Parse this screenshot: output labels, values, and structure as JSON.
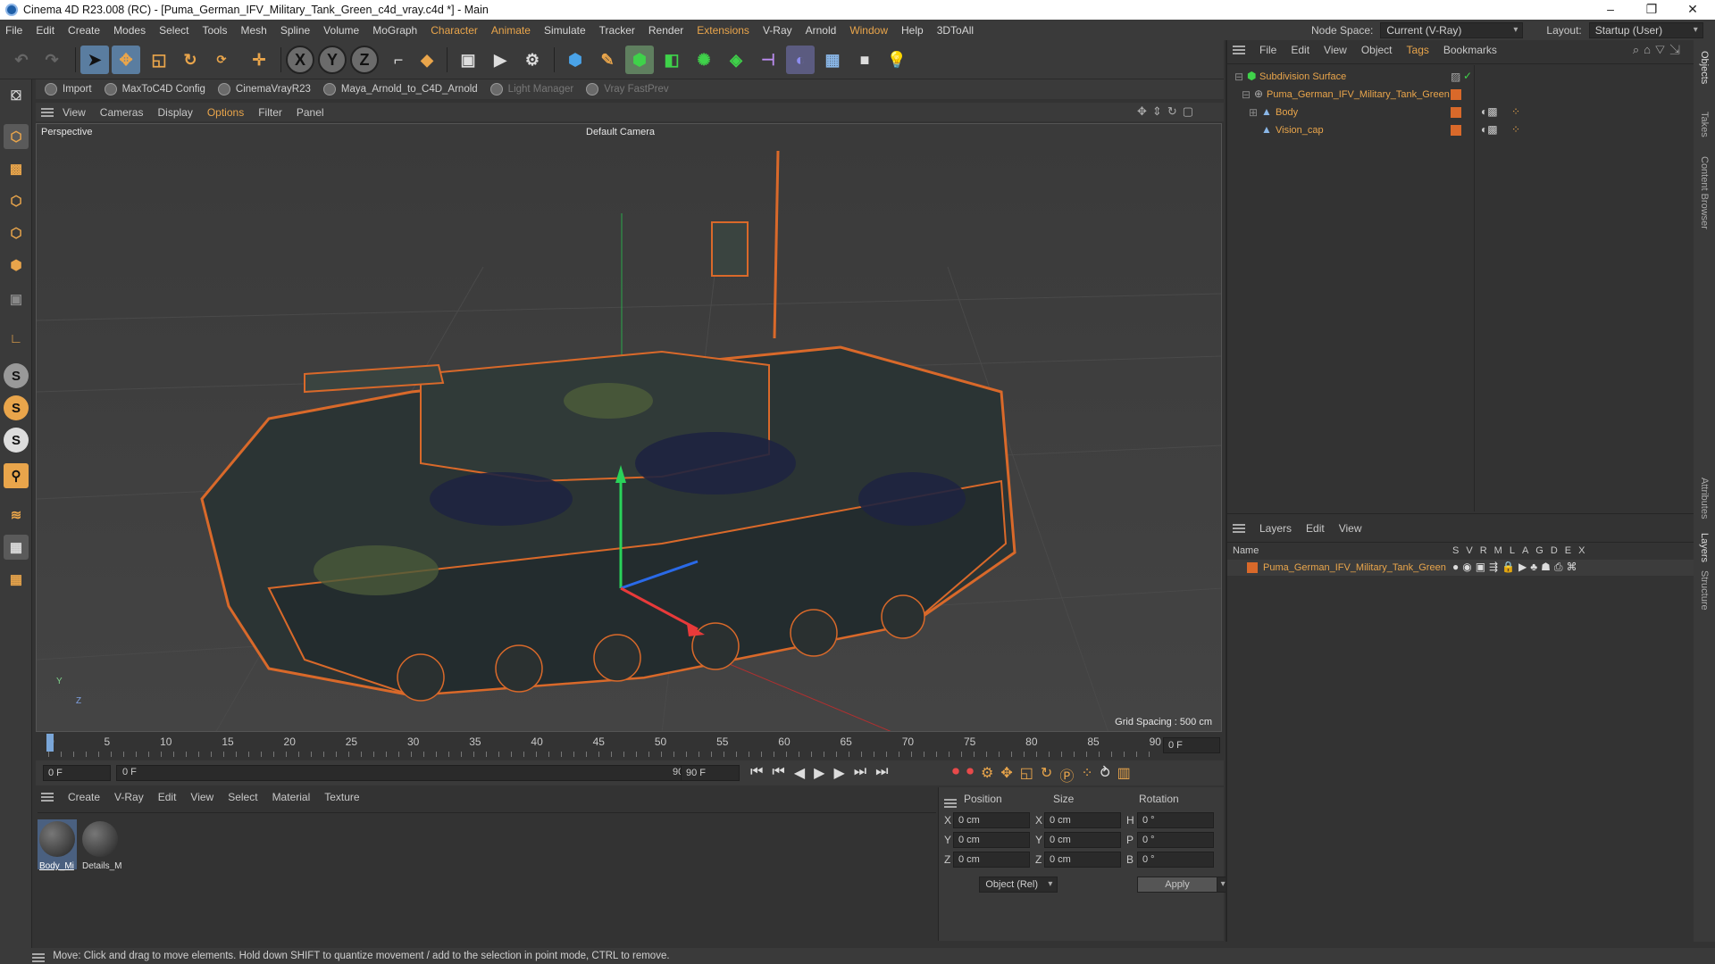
{
  "title_bar": {
    "title": "Cinema 4D R23.008 (RC) - [Puma_German_IFV_Military_Tank_Green_c4d_vray.c4d *] - Main",
    "minimize": "–",
    "maximize": "❐",
    "close": "✕"
  },
  "menu": [
    "File",
    "Edit",
    "Create",
    "Modes",
    "Select",
    "Tools",
    "Mesh",
    "Spline",
    "Volume",
    "MoGraph",
    "Character",
    "Animate",
    "Simulate",
    "Tracker",
    "Render",
    "Extensions",
    "V-Ray",
    "Arnold",
    "Window",
    "Help",
    "3DToAll"
  ],
  "node_space": {
    "label": "Node Space:",
    "value": "Current (V-Ray)"
  },
  "layout": {
    "label": "Layout:",
    "value": "Startup (User)"
  },
  "plugins": [
    "Import",
    "MaxToC4D Config",
    "CinemaVrayR23",
    "Maya_Arnold_to_C4D_Arnold",
    "Light Manager",
    "Vray FastPrev"
  ],
  "viewport_menu": [
    "View",
    "Cameras",
    "Display",
    "Options",
    "Filter",
    "Panel"
  ],
  "viewport": {
    "name": "Perspective",
    "camera": "Default Camera",
    "grid_spacing": "Grid Spacing : 500 cm",
    "axis_y": "Y",
    "axis_z": "Z"
  },
  "timeline": {
    "ticks": [
      "0",
      "5",
      "10",
      "15",
      "20",
      "25",
      "30",
      "35",
      "40",
      "45",
      "50",
      "55",
      "60",
      "65",
      "70",
      "75",
      "80",
      "85",
      "90"
    ],
    "end_frame": "0 F"
  },
  "playback": {
    "current_frame": "0 F",
    "range_start": "0 F",
    "range_end": "90 F",
    "max_frame": "90 F"
  },
  "material_manager": {
    "menu": [
      "Create",
      "V-Ray",
      "Edit",
      "View",
      "Select",
      "Material",
      "Texture"
    ],
    "materials": [
      "Body_Mi",
      "Details_M"
    ]
  },
  "coordinates": {
    "headers": [
      "Position",
      "Size",
      "Rotation"
    ],
    "rows": [
      {
        "axis": "X",
        "pos": "0 cm",
        "size_axis": "X",
        "size": "0 cm",
        "rot_axis": "H",
        "rot": "0 °"
      },
      {
        "axis": "Y",
        "pos": "0 cm",
        "size_axis": "Y",
        "size": "0 cm",
        "rot_axis": "P",
        "rot": "0 °"
      },
      {
        "axis": "Z",
        "pos": "0 cm",
        "size_axis": "Z",
        "size": "0 cm",
        "rot_axis": "B",
        "rot": "0 °"
      }
    ],
    "mode": "Object (Rel)",
    "size_mode": "Size",
    "apply": "Apply"
  },
  "object_manager": {
    "menu": [
      "File",
      "Edit",
      "View",
      "Object",
      "Tags",
      "Bookmarks"
    ],
    "objects": [
      {
        "name": "Subdivision Surface"
      },
      {
        "name": "Puma_German_IFV_Military_Tank_Green"
      },
      {
        "name": "Body"
      },
      {
        "name": "Vision_cap"
      }
    ]
  },
  "layer_manager": {
    "menu": [
      "Layers",
      "Edit",
      "View"
    ],
    "col_name": "Name",
    "flags": [
      "S",
      "V",
      "R",
      "M",
      "L",
      "A",
      "G",
      "D",
      "E",
      "X"
    ],
    "layers": [
      {
        "name": "Puma_German_IFV_Military_Tank_Green"
      }
    ]
  },
  "side_tabs": [
    "Objects",
    "Takes",
    "Content Browser",
    "Attributes",
    "Layers",
    "Structure"
  ],
  "status": "Move: Click and drag to move elements. Hold down SHIFT to quantize movement / add to the selection in point mode, CTRL to remove.",
  "colors": {
    "accent": "#e9a54b",
    "layer": "#d9692a",
    "active_tool": "#5a7da0"
  }
}
